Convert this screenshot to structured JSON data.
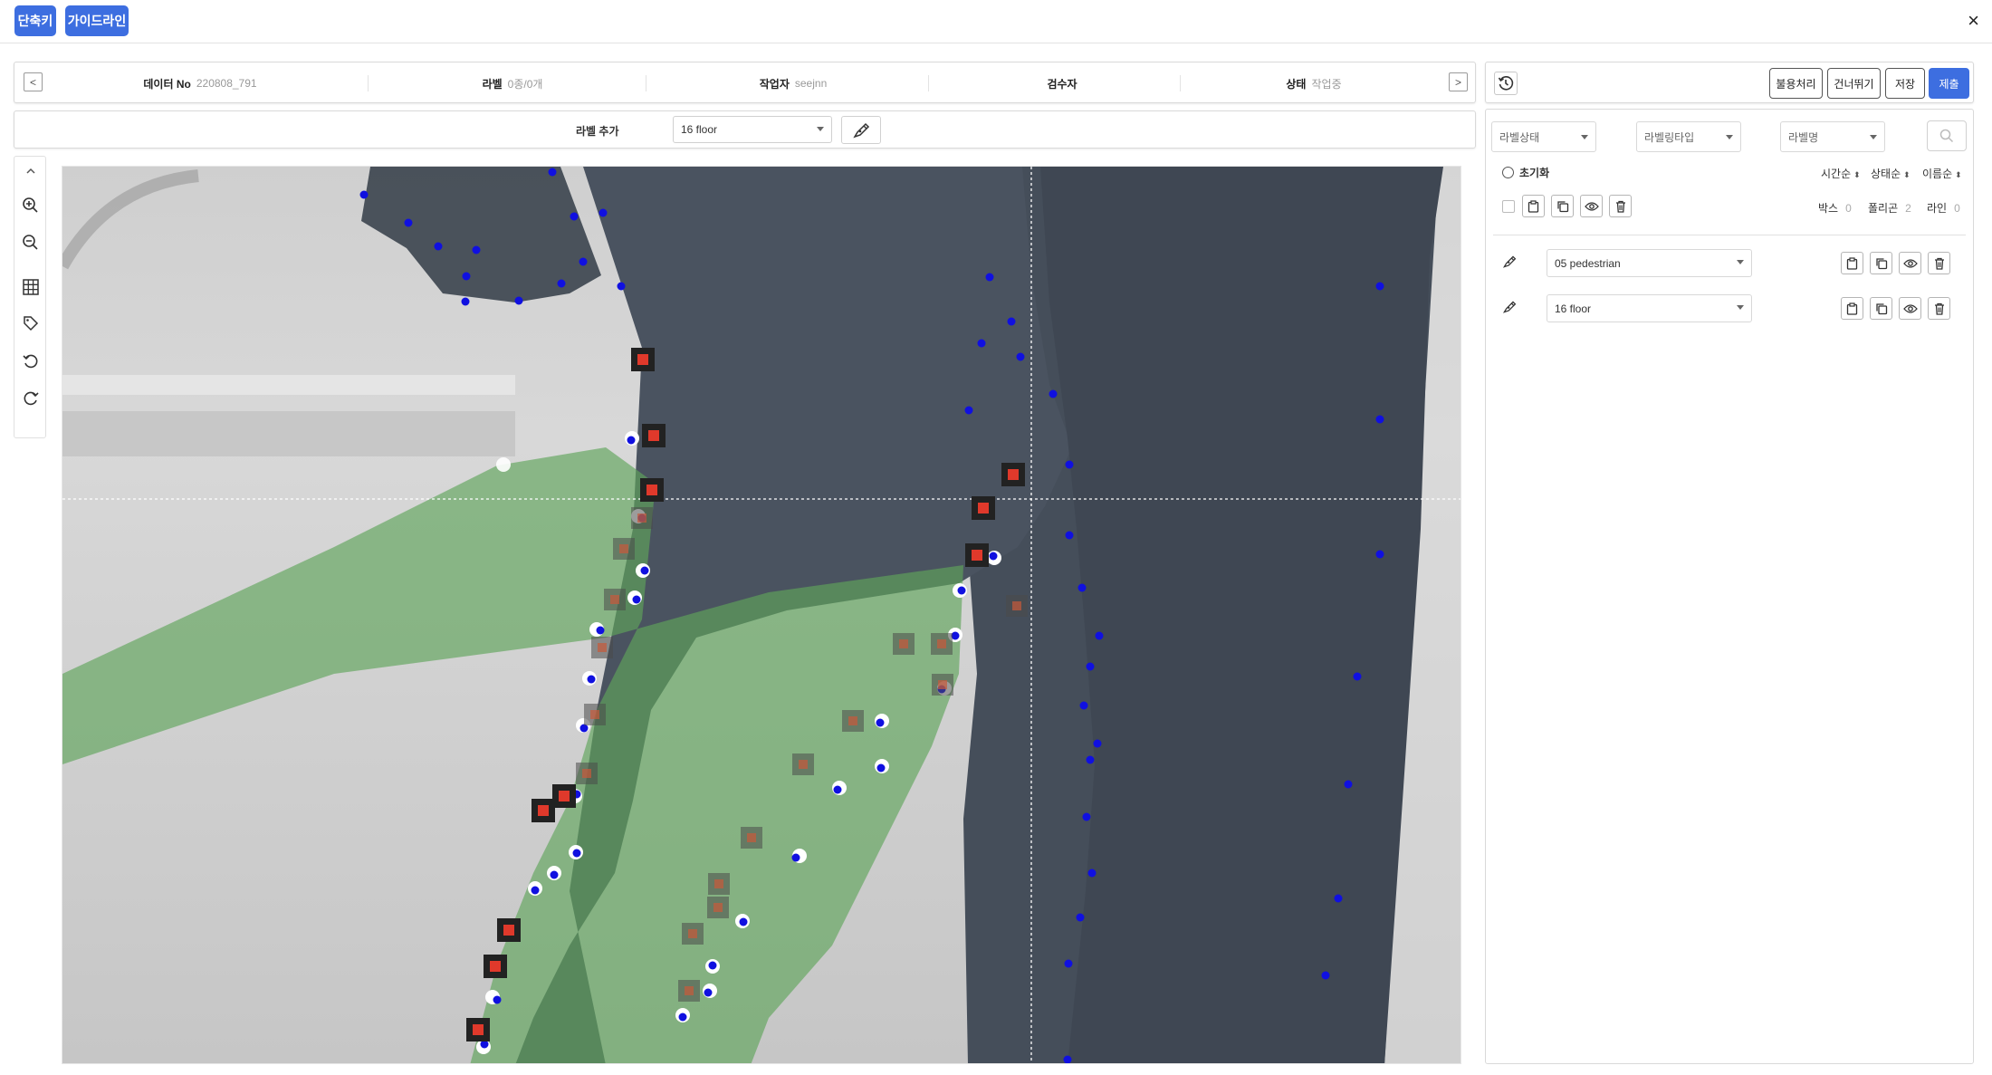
{
  "topbar": {
    "shortcut_label": "단축키",
    "guideline_label": "가이드라인",
    "close_label": "×"
  },
  "info": {
    "prev_label": "<",
    "next_label": ">",
    "data_no_key": "데이터 No",
    "data_no_val": "220808_791",
    "label_key": "라벨",
    "label_val": "0종/0개",
    "worker_key": "작업자",
    "worker_val": "seejnn",
    "reviewer_key": "검수자",
    "reviewer_val": "",
    "status_key": "상태",
    "status_val": "작업중"
  },
  "label_bar": {
    "add_label": "라벨 추가",
    "selected_class": "16 floor"
  },
  "actions": {
    "reject": "불용처리",
    "skip": "건너뛰기",
    "save": "저장",
    "submit": "제출"
  },
  "filters": {
    "label_status": "라벨상태",
    "labeling_type": "라벨링타입",
    "label_name": "라벨명"
  },
  "list_controls": {
    "reset": "초기화",
    "sort_time": "시간순",
    "sort_status": "상태순",
    "sort_name": "이름순",
    "box_key": "박스",
    "box_count": "0",
    "polygon_key": "폴리곤",
    "polygon_count": "2",
    "line_key": "라인",
    "line_count": "0"
  },
  "labels": [
    {
      "class": "05 pedestrian",
      "icon": "pen-icon"
    },
    {
      "class": "16 floor",
      "icon": "pen-icon"
    }
  ],
  "colors": {
    "accent": "#3d6ee0",
    "polygon_fill": "#5fa55a",
    "vertex": "#1010e0",
    "handle": "#e0392b"
  }
}
